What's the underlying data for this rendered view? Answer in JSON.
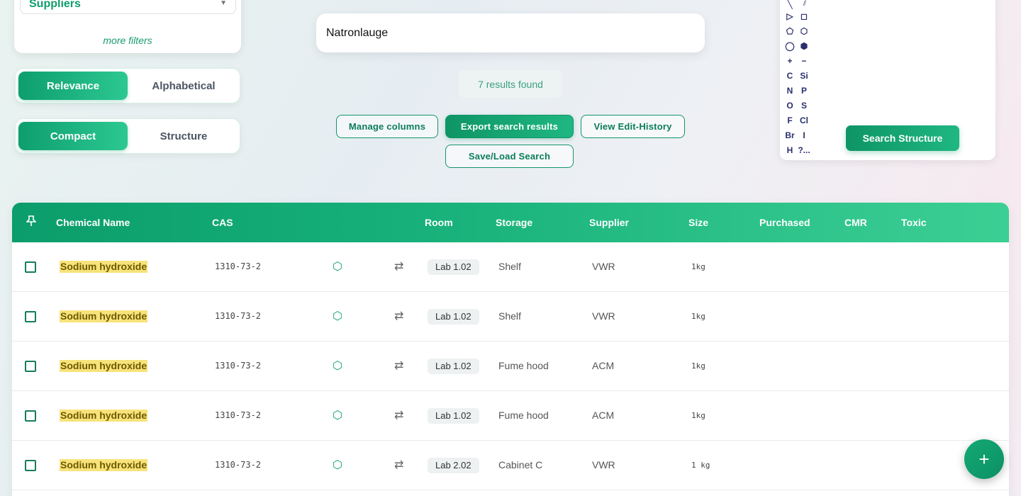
{
  "filters": {
    "supplier_select": "Suppliers",
    "more_filters": "more filters"
  },
  "sort_toggle": {
    "options": [
      "Relevance",
      "Alphabetical"
    ],
    "active": "Relevance"
  },
  "view_toggle": {
    "options": [
      "Compact",
      "Structure"
    ],
    "active": "Compact"
  },
  "search": {
    "query": "Natronlauge",
    "results_text": "7 results found"
  },
  "actions": {
    "manage_columns": "Manage columns",
    "export_results": "Export search results",
    "view_edit_history": "View Edit-History",
    "save_load_search": "Save/Load Search"
  },
  "structure_editor": {
    "tools_left": [
      "▷",
      "⬠",
      "◯",
      "+",
      "C",
      "N",
      "O",
      "F",
      "Br",
      "H"
    ],
    "tools_right": [
      "◻",
      "⬡",
      "⬢",
      "−",
      "Si",
      "P",
      "S",
      "Cl",
      "I",
      "?..."
    ],
    "search_button": "Search Structure"
  },
  "table": {
    "pin_icon": "pin-icon",
    "headers": {
      "name": "Chemical Name",
      "cas": "CAS",
      "room": "Room",
      "storage": "Storage",
      "supplier": "Supplier",
      "size": "Size",
      "purchased": "Purchased",
      "cmr": "CMR",
      "toxic": "Toxic"
    },
    "rows": [
      {
        "name": "Sodium hydroxide",
        "cas": "1310-73-2",
        "room": "Lab 1.02",
        "storage": "Shelf",
        "supplier": "VWR",
        "size": "1kg"
      },
      {
        "name": "Sodium hydroxide",
        "cas": "1310-73-2",
        "room": "Lab 1.02",
        "storage": "Shelf",
        "supplier": "VWR",
        "size": "1kg"
      },
      {
        "name": "Sodium hydroxide",
        "cas": "1310-73-2",
        "room": "Lab 1.02",
        "storage": "Fume hood",
        "supplier": "ACM",
        "size": "1kg"
      },
      {
        "name": "Sodium hydroxide",
        "cas": "1310-73-2",
        "room": "Lab 1.02",
        "storage": "Fume hood",
        "supplier": "ACM",
        "size": "1kg"
      },
      {
        "name": "Sodium hydroxide",
        "cas": "1310-73-2",
        "room": "Lab 2.02",
        "storage": "Cabinet C",
        "supplier": "VWR",
        "size": "1 kg"
      }
    ]
  },
  "fab_label": "+",
  "colors": {
    "accent": "#0e9e6e",
    "highlight": "#f8e27a"
  }
}
